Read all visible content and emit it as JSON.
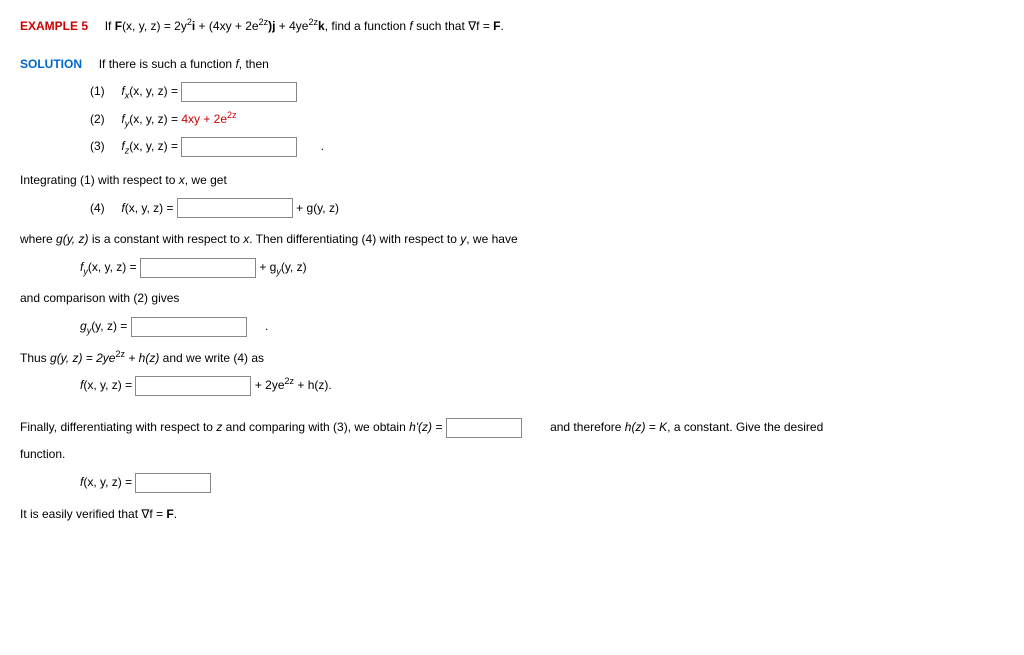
{
  "example": {
    "label": "EXAMPLE 5",
    "prompt_prefix": "If ",
    "F_expr_pre": "F",
    "F_args": "(x, y, z) = 2y",
    "F_part2": "i",
    "F_plus1": " + (4xy + 2e",
    "F_part3": ")j",
    "F_plus2": " + 4ye",
    "F_part4": "k",
    "prompt_suffix": ",  find a function ",
    "fname": "f",
    "prompt_suffix2": " such that  ∇f = ",
    "F_end": "F",
    "period": "."
  },
  "solution": {
    "label": "SOLUTION",
    "intro": "If there is such a function ",
    "fname": "f",
    "intro2": ", then"
  },
  "eqns": {
    "n1": "(1)",
    "n2": "(2)",
    "n3": "(3)",
    "n4": "(4)",
    "fx": "f",
    "fx_sub": "x",
    "args": "(x, y, z) = ",
    "fy": "f",
    "fy_sub": "y",
    "fy_rhs": "4xy + 2e",
    "fz": "f",
    "fz_sub": "z",
    "period": "."
  },
  "text": {
    "integrating": "Integrating (1) with respect to ",
    "x_var": "x",
    "we_get": ", we get",
    "eq4_lhs": "f",
    "plus_g": " + g(y, z)",
    "where_g": "where  ",
    "g_expr": "g(y, z)",
    "where_g2": "  is a constant with respect to ",
    "then_diff": ". Then differentiating (4) with respect to ",
    "y_var": "y",
    "we_have": ", we have",
    "plus_gy": " + g",
    "gy_sub": "y",
    "gy_args": "(y, z)",
    "and_comp": "and comparison with (2) gives",
    "gy_lhs": "g",
    "thus": "Thus  ",
    "g_eq": "g(y, z) = 2ye",
    "plus_h": " + h(z)",
    "and_write": "  and we write (4) as",
    "plus_2ye": " + 2ye",
    "plus_h2": " + h(z).",
    "finally": "Finally, differentiating with respect to ",
    "z_var": "z",
    "and_comp3": " and comparing with (3), we obtain  ",
    "hprime": "h'(z) = ",
    "and_therefore": "and therefore  ",
    "h_eq": "h(z) = K",
    "constant": ",  a constant. Give the desired",
    "function_word": "function.",
    "final_f": "f",
    "verified": "It is easily verified that  ∇f = ",
    "F_final": "F",
    "period_final": "."
  },
  "sup2": "2",
  "sup2z": "2z"
}
